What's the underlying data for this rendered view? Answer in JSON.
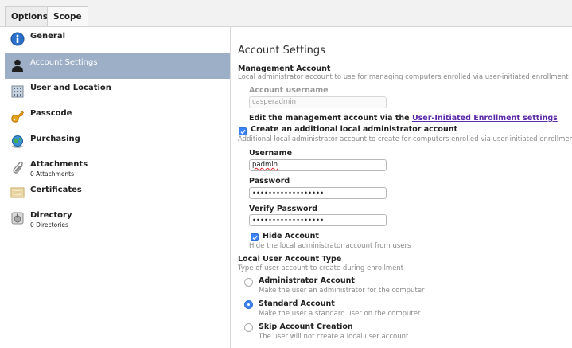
{
  "tabs": {
    "options": "Options",
    "scope": "Scope"
  },
  "sidebar": {
    "items": [
      {
        "label": "General",
        "sub": "",
        "icon": "info-icon"
      },
      {
        "label": "Account Settings",
        "sub": "",
        "icon": "user-silhouette-icon",
        "selected": true
      },
      {
        "label": "User and Location",
        "sub": "",
        "icon": "building-icon"
      },
      {
        "label": "Passcode",
        "sub": "",
        "icon": "key-icon"
      },
      {
        "label": "Purchasing",
        "sub": "",
        "icon": "globe-icon"
      },
      {
        "label": "Attachments",
        "sub": "0 Attachments",
        "icon": "paperclip-icon"
      },
      {
        "label": "Certificates",
        "sub": "",
        "icon": "certificate-icon"
      },
      {
        "label": "Directory",
        "sub": "0 Directories",
        "icon": "directory-icon"
      }
    ]
  },
  "main": {
    "title": "Account Settings",
    "management": {
      "heading": "Management Account",
      "description": "Local administrator account to use for managing computers enrolled via user-initiated enrollment",
      "username_label": "Account username",
      "username_value": "casperadmin",
      "edit_text": "Edit the management account via the ",
      "edit_link": "User-Initiated Enrollment settings"
    },
    "additional": {
      "checkbox_label": "Create an additional local administrator account",
      "checked": true,
      "description": "Additional local administrator account to create for computers enrolled via user-initiated enrollment",
      "username_label": "Username",
      "username_value": "padmin",
      "password_label": "Password",
      "password_value": "••••••••••••••••••",
      "verify_label": "Verify Password",
      "verify_value": "••••••••••••••••••",
      "hide_label": "Hide Account",
      "hide_checked": true,
      "hide_description": "Hide the local administrator account from users"
    },
    "local_user": {
      "heading": "Local User Account Type",
      "description": "Type of user account to create during enrollment",
      "options": [
        {
          "label": "Administrator Account",
          "description": "Make the user an administrator for the computer",
          "selected": false
        },
        {
          "label": "Standard Account",
          "description": "Make the user a standard user on the computer",
          "selected": true
        },
        {
          "label": "Skip Account Creation",
          "description": "The user will not create a local user account",
          "selected": false
        }
      ]
    }
  },
  "colors": {
    "selected_row": "#9cafc6",
    "accent": "#3b82f6",
    "link": "#5b2aa8"
  }
}
